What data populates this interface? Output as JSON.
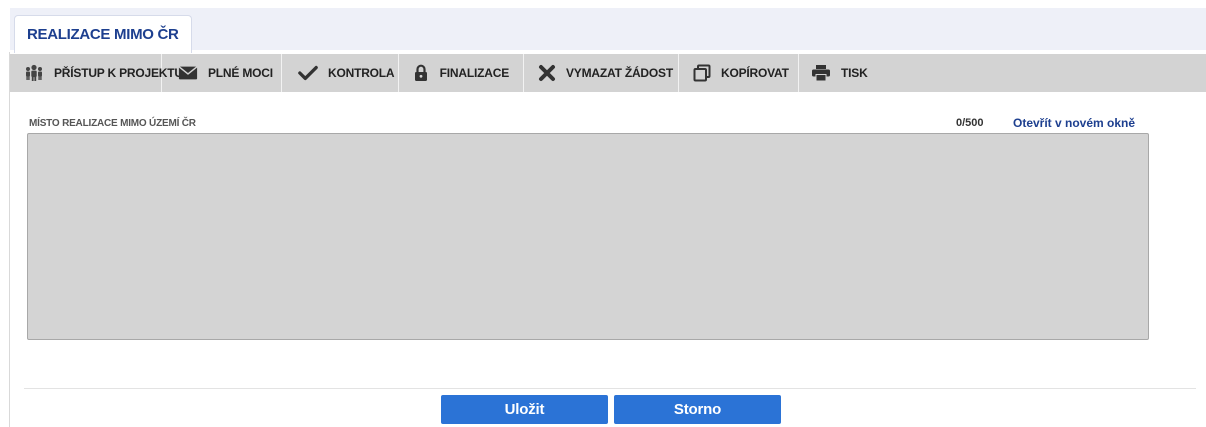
{
  "tabs": [
    {
      "label": "REALIZACE MIMO ČR",
      "active": true
    }
  ],
  "toolbar": {
    "items": [
      {
        "label": "PŘÍSTUP K PROJEKTU",
        "icon": "people-icon"
      },
      {
        "label": "PLNÉ MOCI",
        "icon": "envelope-icon"
      },
      {
        "label": "KONTROLA",
        "icon": "checkmark-icon"
      },
      {
        "label": "FINALIZACE",
        "icon": "lock-icon"
      },
      {
        "label": "VYMAZAT ŽÁDOST",
        "icon": "x-icon"
      },
      {
        "label": "KOPÍROVAT",
        "icon": "copy-icon"
      },
      {
        "label": "TISK",
        "icon": "printer-icon"
      }
    ]
  },
  "field": {
    "label": "MÍSTO REALIZACE MIMO ÚZEMÍ ČR",
    "counter": "0/500",
    "open_link": "Otevřít v novém okně",
    "value": ""
  },
  "actions": {
    "save_label": "Uložit",
    "cancel_label": "Storno"
  },
  "colors": {
    "accent": "#2b73d6",
    "title_text": "#1d3f8f",
    "toolbar_bg": "#d3d3d3",
    "textarea_bg": "#d4d4d4"
  }
}
